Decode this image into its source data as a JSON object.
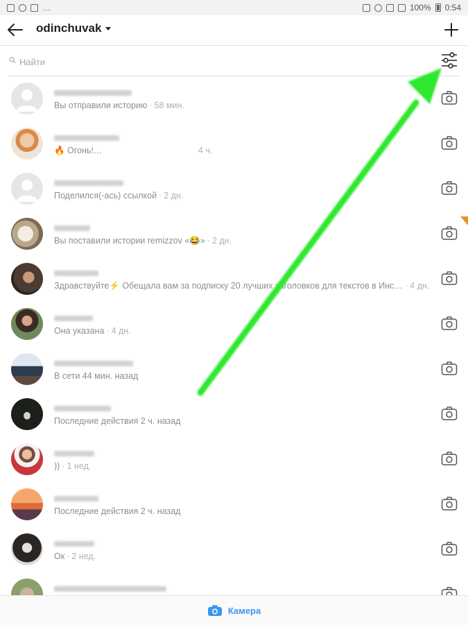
{
  "status_bar": {
    "left_icons": [
      "gallery-icon",
      "at-icon",
      "hangouts-icon",
      "more-dots"
    ],
    "left_more": "…",
    "battery": "100%",
    "time": "0:54"
  },
  "header": {
    "username": "odinchuvak"
  },
  "search": {
    "placeholder": "Найти"
  },
  "conversations": [
    {
      "preview": "Вы отправили историю",
      "time": "58 мин."
    },
    {
      "preview": "🔥 Огонь!…",
      "time": "4 ч."
    },
    {
      "preview": "Поделился(-ась) ссылкой",
      "time": "2 дн."
    },
    {
      "preview": "Вы поставили истории remizzov «😂»",
      "time": "2 дн."
    },
    {
      "preview": "Здравствуйте⚡ Обещала вам за подписку 20 лучших заголовков для текстов в Инс…",
      "time": "4 дн."
    },
    {
      "preview": "Она указана",
      "time": "4 дн."
    },
    {
      "preview": "В сети 44 мин. назад",
      "time": ""
    },
    {
      "preview": "Последние действия 2 ч. назад",
      "time": ""
    },
    {
      "preview": "))",
      "time": "1 нед."
    },
    {
      "preview": "Последние действия 2 ч. назад",
      "time": ""
    },
    {
      "preview": "Ок",
      "time": "2 нед."
    }
  ],
  "bottom": {
    "camera_label": "Камера"
  },
  "colors": {
    "accent": "#3897f0",
    "annotation_arrow": "#2ee82e",
    "side_tab": "#f08c2c"
  }
}
